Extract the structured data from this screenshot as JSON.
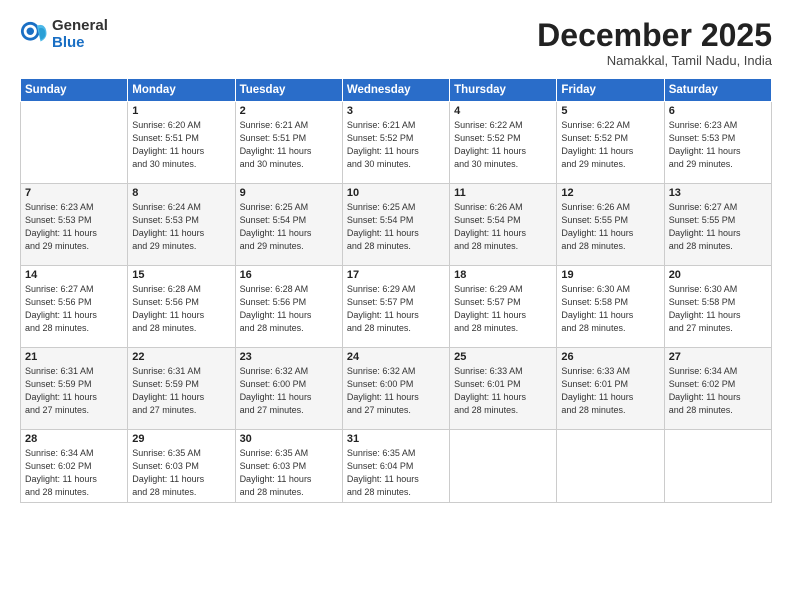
{
  "header": {
    "logo_general": "General",
    "logo_blue": "Blue",
    "month_title": "December 2025",
    "location": "Namakkal, Tamil Nadu, India"
  },
  "days_of_week": [
    "Sunday",
    "Monday",
    "Tuesday",
    "Wednesday",
    "Thursday",
    "Friday",
    "Saturday"
  ],
  "weeks": [
    [
      {
        "day": "",
        "info": ""
      },
      {
        "day": "1",
        "info": "Sunrise: 6:20 AM\nSunset: 5:51 PM\nDaylight: 11 hours\nand 30 minutes."
      },
      {
        "day": "2",
        "info": "Sunrise: 6:21 AM\nSunset: 5:51 PM\nDaylight: 11 hours\nand 30 minutes."
      },
      {
        "day": "3",
        "info": "Sunrise: 6:21 AM\nSunset: 5:52 PM\nDaylight: 11 hours\nand 30 minutes."
      },
      {
        "day": "4",
        "info": "Sunrise: 6:22 AM\nSunset: 5:52 PM\nDaylight: 11 hours\nand 30 minutes."
      },
      {
        "day": "5",
        "info": "Sunrise: 6:22 AM\nSunset: 5:52 PM\nDaylight: 11 hours\nand 29 minutes."
      },
      {
        "day": "6",
        "info": "Sunrise: 6:23 AM\nSunset: 5:53 PM\nDaylight: 11 hours\nand 29 minutes."
      }
    ],
    [
      {
        "day": "7",
        "info": "Sunrise: 6:23 AM\nSunset: 5:53 PM\nDaylight: 11 hours\nand 29 minutes."
      },
      {
        "day": "8",
        "info": "Sunrise: 6:24 AM\nSunset: 5:53 PM\nDaylight: 11 hours\nand 29 minutes."
      },
      {
        "day": "9",
        "info": "Sunrise: 6:25 AM\nSunset: 5:54 PM\nDaylight: 11 hours\nand 29 minutes."
      },
      {
        "day": "10",
        "info": "Sunrise: 6:25 AM\nSunset: 5:54 PM\nDaylight: 11 hours\nand 28 minutes."
      },
      {
        "day": "11",
        "info": "Sunrise: 6:26 AM\nSunset: 5:54 PM\nDaylight: 11 hours\nand 28 minutes."
      },
      {
        "day": "12",
        "info": "Sunrise: 6:26 AM\nSunset: 5:55 PM\nDaylight: 11 hours\nand 28 minutes."
      },
      {
        "day": "13",
        "info": "Sunrise: 6:27 AM\nSunset: 5:55 PM\nDaylight: 11 hours\nand 28 minutes."
      }
    ],
    [
      {
        "day": "14",
        "info": "Sunrise: 6:27 AM\nSunset: 5:56 PM\nDaylight: 11 hours\nand 28 minutes."
      },
      {
        "day": "15",
        "info": "Sunrise: 6:28 AM\nSunset: 5:56 PM\nDaylight: 11 hours\nand 28 minutes."
      },
      {
        "day": "16",
        "info": "Sunrise: 6:28 AM\nSunset: 5:56 PM\nDaylight: 11 hours\nand 28 minutes."
      },
      {
        "day": "17",
        "info": "Sunrise: 6:29 AM\nSunset: 5:57 PM\nDaylight: 11 hours\nand 28 minutes."
      },
      {
        "day": "18",
        "info": "Sunrise: 6:29 AM\nSunset: 5:57 PM\nDaylight: 11 hours\nand 28 minutes."
      },
      {
        "day": "19",
        "info": "Sunrise: 6:30 AM\nSunset: 5:58 PM\nDaylight: 11 hours\nand 28 minutes."
      },
      {
        "day": "20",
        "info": "Sunrise: 6:30 AM\nSunset: 5:58 PM\nDaylight: 11 hours\nand 27 minutes."
      }
    ],
    [
      {
        "day": "21",
        "info": "Sunrise: 6:31 AM\nSunset: 5:59 PM\nDaylight: 11 hours\nand 27 minutes."
      },
      {
        "day": "22",
        "info": "Sunrise: 6:31 AM\nSunset: 5:59 PM\nDaylight: 11 hours\nand 27 minutes."
      },
      {
        "day": "23",
        "info": "Sunrise: 6:32 AM\nSunset: 6:00 PM\nDaylight: 11 hours\nand 27 minutes."
      },
      {
        "day": "24",
        "info": "Sunrise: 6:32 AM\nSunset: 6:00 PM\nDaylight: 11 hours\nand 27 minutes."
      },
      {
        "day": "25",
        "info": "Sunrise: 6:33 AM\nSunset: 6:01 PM\nDaylight: 11 hours\nand 28 minutes."
      },
      {
        "day": "26",
        "info": "Sunrise: 6:33 AM\nSunset: 6:01 PM\nDaylight: 11 hours\nand 28 minutes."
      },
      {
        "day": "27",
        "info": "Sunrise: 6:34 AM\nSunset: 6:02 PM\nDaylight: 11 hours\nand 28 minutes."
      }
    ],
    [
      {
        "day": "28",
        "info": "Sunrise: 6:34 AM\nSunset: 6:02 PM\nDaylight: 11 hours\nand 28 minutes."
      },
      {
        "day": "29",
        "info": "Sunrise: 6:35 AM\nSunset: 6:03 PM\nDaylight: 11 hours\nand 28 minutes."
      },
      {
        "day": "30",
        "info": "Sunrise: 6:35 AM\nSunset: 6:03 PM\nDaylight: 11 hours\nand 28 minutes."
      },
      {
        "day": "31",
        "info": "Sunrise: 6:35 AM\nSunset: 6:04 PM\nDaylight: 11 hours\nand 28 minutes."
      },
      {
        "day": "",
        "info": ""
      },
      {
        "day": "",
        "info": ""
      },
      {
        "day": "",
        "info": ""
      }
    ]
  ]
}
